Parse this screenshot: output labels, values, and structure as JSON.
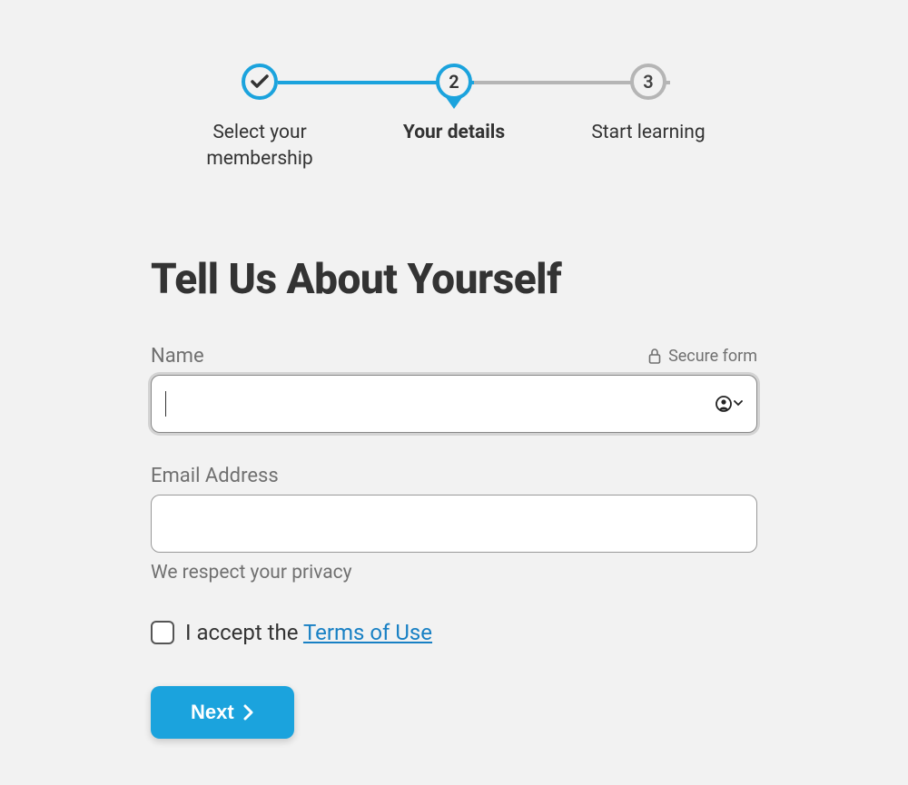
{
  "stepper": {
    "steps": [
      {
        "label": "Select your membership",
        "state": "completed"
      },
      {
        "label": "Your details",
        "state": "active",
        "number": "2"
      },
      {
        "label": "Start learning",
        "state": "upcoming",
        "number": "3"
      }
    ]
  },
  "page": {
    "title": "Tell Us About Yourself"
  },
  "form": {
    "name_label": "Name",
    "secure_label": "Secure form",
    "email_label": "Email Address",
    "email_hint": "We respect your privacy",
    "name_value": "",
    "email_value": ""
  },
  "consent": {
    "prefix": "I accept the ",
    "link_text": "Terms of Use"
  },
  "actions": {
    "next_label": "Next"
  }
}
